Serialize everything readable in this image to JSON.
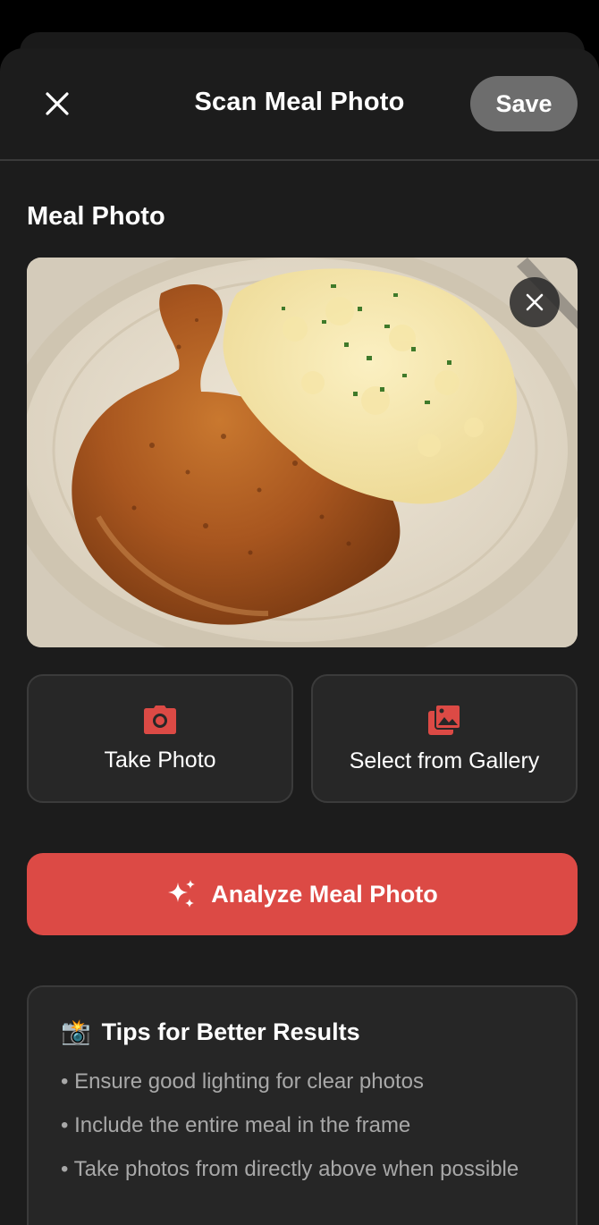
{
  "header": {
    "title": "Scan Meal Photo",
    "save_label": "Save",
    "close_icon": "close-icon"
  },
  "section": {
    "label": "Meal Photo"
  },
  "photo": {
    "remove_icon": "close-icon"
  },
  "actions": {
    "take_photo": {
      "label": "Take Photo",
      "icon": "camera-icon"
    },
    "gallery": {
      "label": "Select from Gallery",
      "icon": "gallery-icon"
    }
  },
  "analyze": {
    "label": "Analyze Meal Photo",
    "icon": "sparkles-icon"
  },
  "tips": {
    "emoji": "📸",
    "title": "Tips for Better Results",
    "items": [
      "• Ensure good lighting for clear photos",
      "• Include the entire meal in the frame",
      "• Take photos from directly above when possible"
    ]
  },
  "colors": {
    "accent": "#dc4a45",
    "background": "#1c1c1c",
    "card": "#272727",
    "save_button": "#6d6d6d"
  }
}
